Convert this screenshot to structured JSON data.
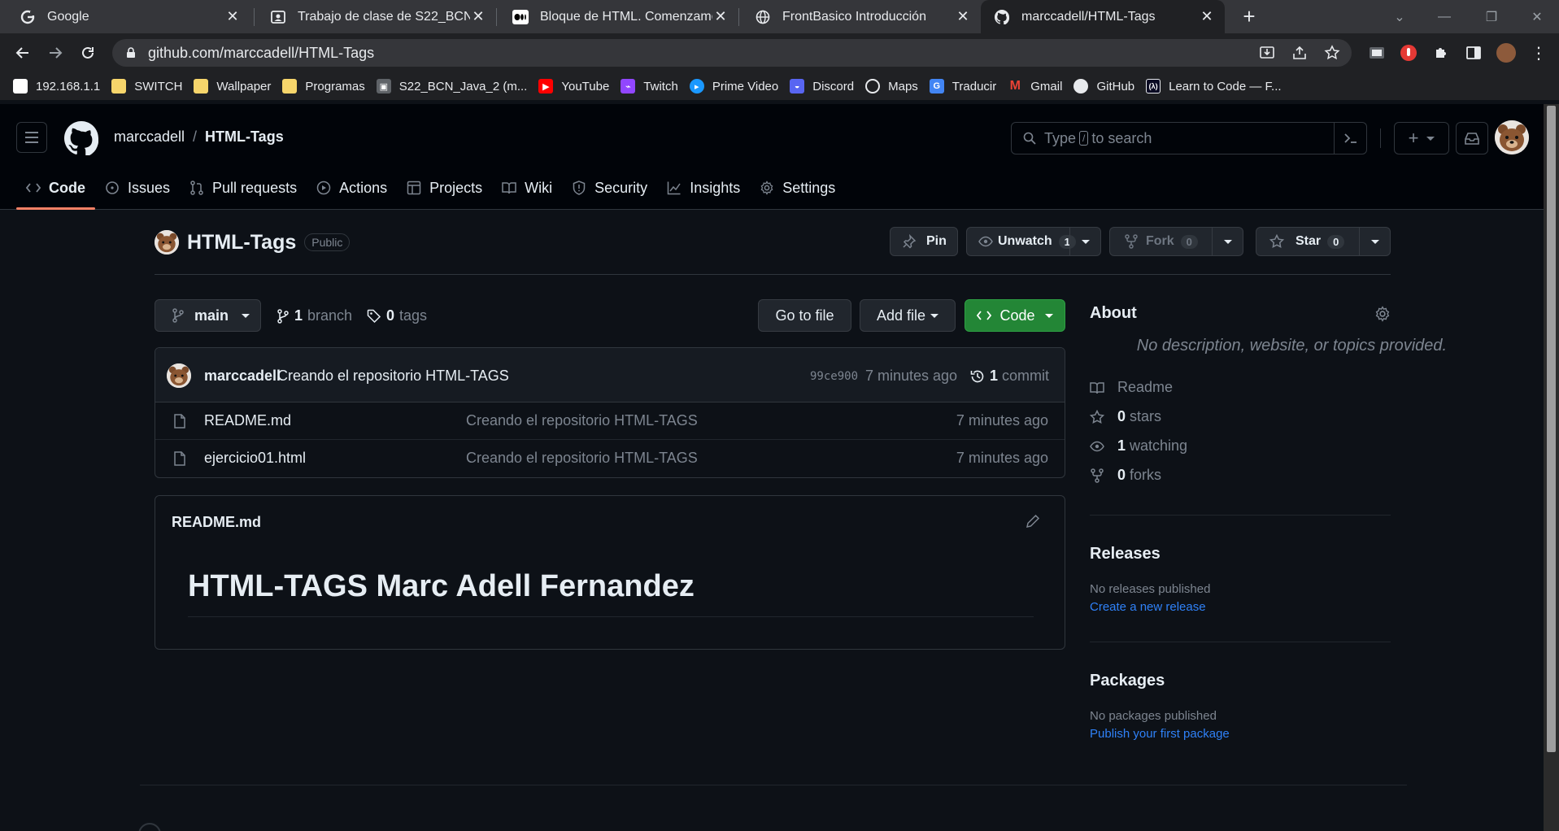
{
  "browser": {
    "tabs": [
      {
        "title": "Google",
        "icon": "google-icon"
      },
      {
        "title": "Trabajo de clase de S22_BCN_Java_2",
        "icon": "classroom-icon"
      },
      {
        "title": "Bloque de HTML. Comenzamos con",
        "icon": "medium-icon"
      },
      {
        "title": "FrontBasico Introducción",
        "icon": "globe-icon"
      },
      {
        "title": "marccadell/HTML-Tags",
        "icon": "github-icon"
      }
    ],
    "url": "github.com/marccadell/HTML-Tags",
    "bookmarks": [
      {
        "label": "192.168.1.1",
        "icon": "page-icon"
      },
      {
        "label": "SWITCH",
        "icon": "folder-icon"
      },
      {
        "label": "Wallpaper",
        "icon": "folder-icon"
      },
      {
        "label": "Programas",
        "icon": "folder-icon"
      },
      {
        "label": "S22_BCN_Java_2 (m...",
        "icon": "classroom-icon"
      },
      {
        "label": "YouTube",
        "icon": "youtube-icon"
      },
      {
        "label": "Twitch",
        "icon": "twitch-icon"
      },
      {
        "label": "Prime Video",
        "icon": "prime-video-icon"
      },
      {
        "label": "Discord",
        "icon": "discord-icon"
      },
      {
        "label": "Maps",
        "icon": "maps-icon"
      },
      {
        "label": "Traducir",
        "icon": "translate-icon"
      },
      {
        "label": "Gmail",
        "icon": "gmail-icon"
      },
      {
        "label": "GitHub",
        "icon": "github-icon"
      },
      {
        "label": "Learn to Code — F...",
        "icon": "freecodecamp-icon"
      }
    ]
  },
  "header": {
    "owner": "marccadell",
    "separator": "/",
    "repo": "HTML-Tags",
    "search_prefix": "Type",
    "search_key": "/",
    "search_suffix": "to search"
  },
  "repo_nav": [
    {
      "label": "Code",
      "icon": "code-icon"
    },
    {
      "label": "Issues",
      "icon": "issues-icon"
    },
    {
      "label": "Pull requests",
      "icon": "pull-request-icon"
    },
    {
      "label": "Actions",
      "icon": "actions-icon"
    },
    {
      "label": "Projects",
      "icon": "projects-icon"
    },
    {
      "label": "Wiki",
      "icon": "wiki-icon"
    },
    {
      "label": "Security",
      "icon": "shield-icon"
    },
    {
      "label": "Insights",
      "icon": "graph-icon"
    },
    {
      "label": "Settings",
      "icon": "gear-icon"
    }
  ],
  "repo": {
    "name": "HTML-Tags",
    "visibility": "Public",
    "pin_label": "Pin",
    "watch_label": "Unwatch",
    "watch_count": "1",
    "fork_label": "Fork",
    "fork_count": "0",
    "star_label": "Star",
    "star_count": "0"
  },
  "file_nav": {
    "branch": "main",
    "branch_count": "1",
    "branch_label": "branch",
    "tag_count": "0",
    "tag_label": "tags",
    "go_to_file": "Go to file",
    "add_file": "Add file",
    "code": "Code"
  },
  "commit": {
    "author": "marccadell",
    "message": "Creando el repositorio HTML-TAGS",
    "sha": "99ce900",
    "ago": "7 minutes ago",
    "count": "1",
    "count_label": "commit"
  },
  "files": [
    {
      "name": "README.md",
      "message": "Creando el repositorio HTML-TAGS",
      "date": "7 minutes ago"
    },
    {
      "name": "ejercicio01.html",
      "message": "Creando el repositorio HTML-TAGS",
      "date": "7 minutes ago"
    }
  ],
  "readme": {
    "filename": "README.md",
    "heading": "HTML-TAGS Marc Adell Fernandez"
  },
  "about": {
    "title": "About",
    "description": "No description, website, or topics provided.",
    "readme_label": "Readme",
    "stars_count": "0",
    "stars_label": "stars",
    "watching_count": "1",
    "watching_label": "watching",
    "forks_count": "0",
    "forks_label": "forks"
  },
  "releases": {
    "title": "Releases",
    "empty": "No releases published",
    "link": "Create a new release"
  },
  "packages": {
    "title": "Packages",
    "empty": "No packages published",
    "link": "Publish your first package"
  },
  "colors": {
    "page_bg": "#0d1117",
    "header_bg": "#010409",
    "accent_underline": "#f78166",
    "code_button": "#238636",
    "link": "#2f81f7"
  }
}
